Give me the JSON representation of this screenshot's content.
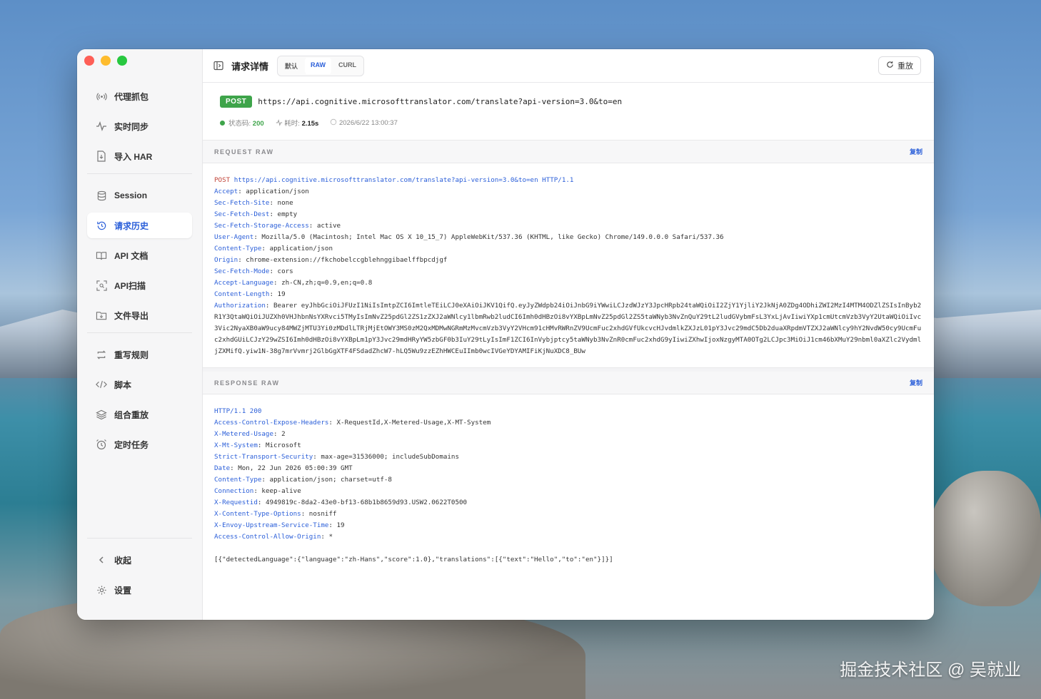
{
  "sidebar": {
    "items": [
      {
        "label": "代理抓包",
        "icon": "broadcast-icon"
      },
      {
        "label": "实时同步",
        "icon": "pulse-icon"
      },
      {
        "label": "导入 HAR",
        "icon": "file-import-icon"
      },
      {
        "label": "Session",
        "icon": "database-icon"
      },
      {
        "label": "请求历史",
        "icon": "history-icon",
        "active": true
      },
      {
        "label": "API 文档",
        "icon": "book-icon"
      },
      {
        "label": "API扫描",
        "icon": "scan-icon"
      },
      {
        "label": "文件导出",
        "icon": "export-icon"
      },
      {
        "label": "重写规则",
        "icon": "rewrite-icon"
      },
      {
        "label": "脚本",
        "icon": "code-icon"
      },
      {
        "label": "组合重放",
        "icon": "layers-icon"
      },
      {
        "label": "定时任务",
        "icon": "alarm-icon"
      }
    ],
    "collapse_label": "收起",
    "settings_label": "设置"
  },
  "toolbar": {
    "title": "请求详情",
    "tabs": [
      "默认",
      "RAW",
      "CURL"
    ],
    "active_tab": "RAW",
    "replay_label": "重放"
  },
  "summary": {
    "method": "POST",
    "url": "https://api.cognitive.microsofttranslator.com/translate?api-version=3.0&to=en",
    "status_label": "状态码:",
    "status_code": "200",
    "time_label": "耗时:",
    "time_value": "2.15s",
    "timestamp": "2026/6/22 13:00:37"
  },
  "request": {
    "title": "REQUEST RAW",
    "copy_label": "复制",
    "request_line": {
      "method": "POST",
      "url": "https://api.cognitive.microsofttranslator.com/translate?api-version=3.0&to=en",
      "version": "HTTP/1.1"
    },
    "headers": [
      [
        "Accept",
        "application/json"
      ],
      [
        "Sec-Fetch-Site",
        "none"
      ],
      [
        "Sec-Fetch-Dest",
        "empty"
      ],
      [
        "Sec-Fetch-Storage-Access",
        "active"
      ],
      [
        "User-Agent",
        "Mozilla/5.0 (Macintosh; Intel Mac OS X 10_15_7) AppleWebKit/537.36 (KHTML, like Gecko) Chrome/149.0.0.0 Safari/537.36"
      ],
      [
        "Content-Type",
        "application/json"
      ],
      [
        "Origin",
        "chrome-extension://fkchobelccgblehnggibaelffbpcdjgf"
      ],
      [
        "Sec-Fetch-Mode",
        "cors"
      ],
      [
        "Accept-Language",
        "zh-CN,zh;q=0.9,en;q=0.8"
      ],
      [
        "Content-Length",
        "19"
      ],
      [
        "Authorization",
        "Bearer eyJhbGciOiJFUzI1NiIsImtpZCI6ImtleTEiLCJ0eXAiOiJKV1QifQ.eyJyZWdpb24iOiJnbG9iYWwiLCJzdWJzY3JpcHRpb24taWQiOiI2ZjY1YjliY2JkNjA0ZDg4ODhiZWI2MzI4MTM4ODZlZSIsInByb2R1Y3QtaWQiOiJUZXh0VHJhbnNsYXRvci5TMyIsImNvZ25pdGl2ZS1zZXJ2aWNlcy1lbmRwb2ludCI6Imh0dHBzOi8vYXBpLmNvZ25pdGl2ZS5taWNyb3NvZnQuY29tL2ludGVybmFsL3YxLjAvIiwiYXp1cmUtcmVzb3VyY2UtaWQiOiIvc3Vic2NyaXB0aW9ucy84MWZjMTU3Yi0zMDdlLTRjMjEtOWY3MS0zM2QxMDMwNGRmMzMvcmVzb3VyY2VHcm91cHMvRWRnZV9UcmFuc2xhdGVfUkcvcHJvdmlkZXJzL01pY3Jvc29mdC5Db2duaXRpdmVTZXJ2aWNlcy9hY2NvdW50cy9UcmFuc2xhdGUiLCJzY29wZSI6Imh0dHBzOi8vYXBpLm1pY3Jvc29mdHRyYW5zbGF0b3IuY29tLyIsImF1ZCI6InVybjptcy5taWNyb3NvZnR0cmFuc2xhdG9yIiwiZXhwIjoxNzgyMTA0OTg2LCJpc3MiOiJ1cm46bXMuY29nbml0aXZlc2VydmljZXMifQ.yiw1N-38g7mrVvmrj2GlbGgXTF4FSdadZhcW7-hLQ5Wu9zzEZhHWCEuIImb0wcIVGeYDYAMIFiKjNuXDC8_BUw"
      ]
    ]
  },
  "response": {
    "title": "RESPONSE RAW",
    "copy_label": "复制",
    "status_line": "HTTP/1.1 200",
    "headers": [
      [
        "Access-Control-Expose-Headers",
        "X-RequestId,X-Metered-Usage,X-MT-System"
      ],
      [
        "X-Metered-Usage",
        "2"
      ],
      [
        "X-Mt-System",
        "Microsoft"
      ],
      [
        "Strict-Transport-Security",
        "max-age=31536000; includeSubDomains"
      ],
      [
        "Date",
        "Mon, 22 Jun 2026 05:00:39 GMT"
      ],
      [
        "Content-Type",
        "application/json; charset=utf-8"
      ],
      [
        "Connection",
        "keep-alive"
      ],
      [
        "X-Requestid",
        "4949819c-8da2-43e0-bf13-68b1b8659d93.USW2.0622T0500"
      ],
      [
        "X-Content-Type-Options",
        "nosniff"
      ],
      [
        "X-Envoy-Upstream-Service-Time",
        "19"
      ],
      [
        "Access-Control-Allow-Origin",
        "*"
      ]
    ],
    "body": "[{\"detectedLanguage\":{\"language\":\"zh-Hans\",\"score\":1.0},\"translations\":[{\"text\":\"Hello\",\"to\":\"en\"}]}]"
  },
  "watermark": "掘金技术社区 @ 吴就业",
  "colors": {
    "accent": "#2b5fd9",
    "method_post": "#3ea44a",
    "header_key": "#2b5fd9"
  }
}
